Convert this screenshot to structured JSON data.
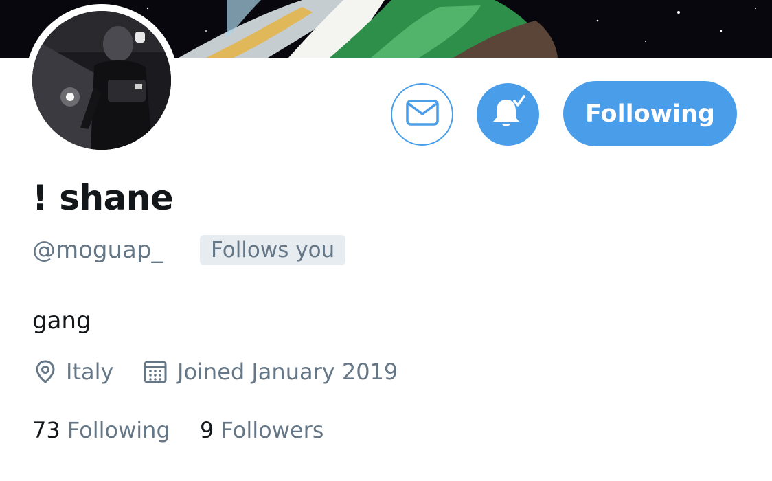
{
  "profile": {
    "display_name": "! shane",
    "handle": "@moguap_",
    "follows_you_badge": "Follows you",
    "bio": "gang",
    "location": "Italy",
    "joined": "Joined January 2019"
  },
  "actions": {
    "follow_label": "Following",
    "message_icon": "envelope-icon",
    "notifications_icon": "bell-check-icon"
  },
  "stats": {
    "following_count": "73",
    "following_label": "Following",
    "followers_count": "9",
    "followers_label": "Followers"
  },
  "colors": {
    "accent": "#4a9de8",
    "text_primary": "#14171a",
    "text_secondary": "#657786",
    "badge_bg": "#e6ecf0"
  }
}
